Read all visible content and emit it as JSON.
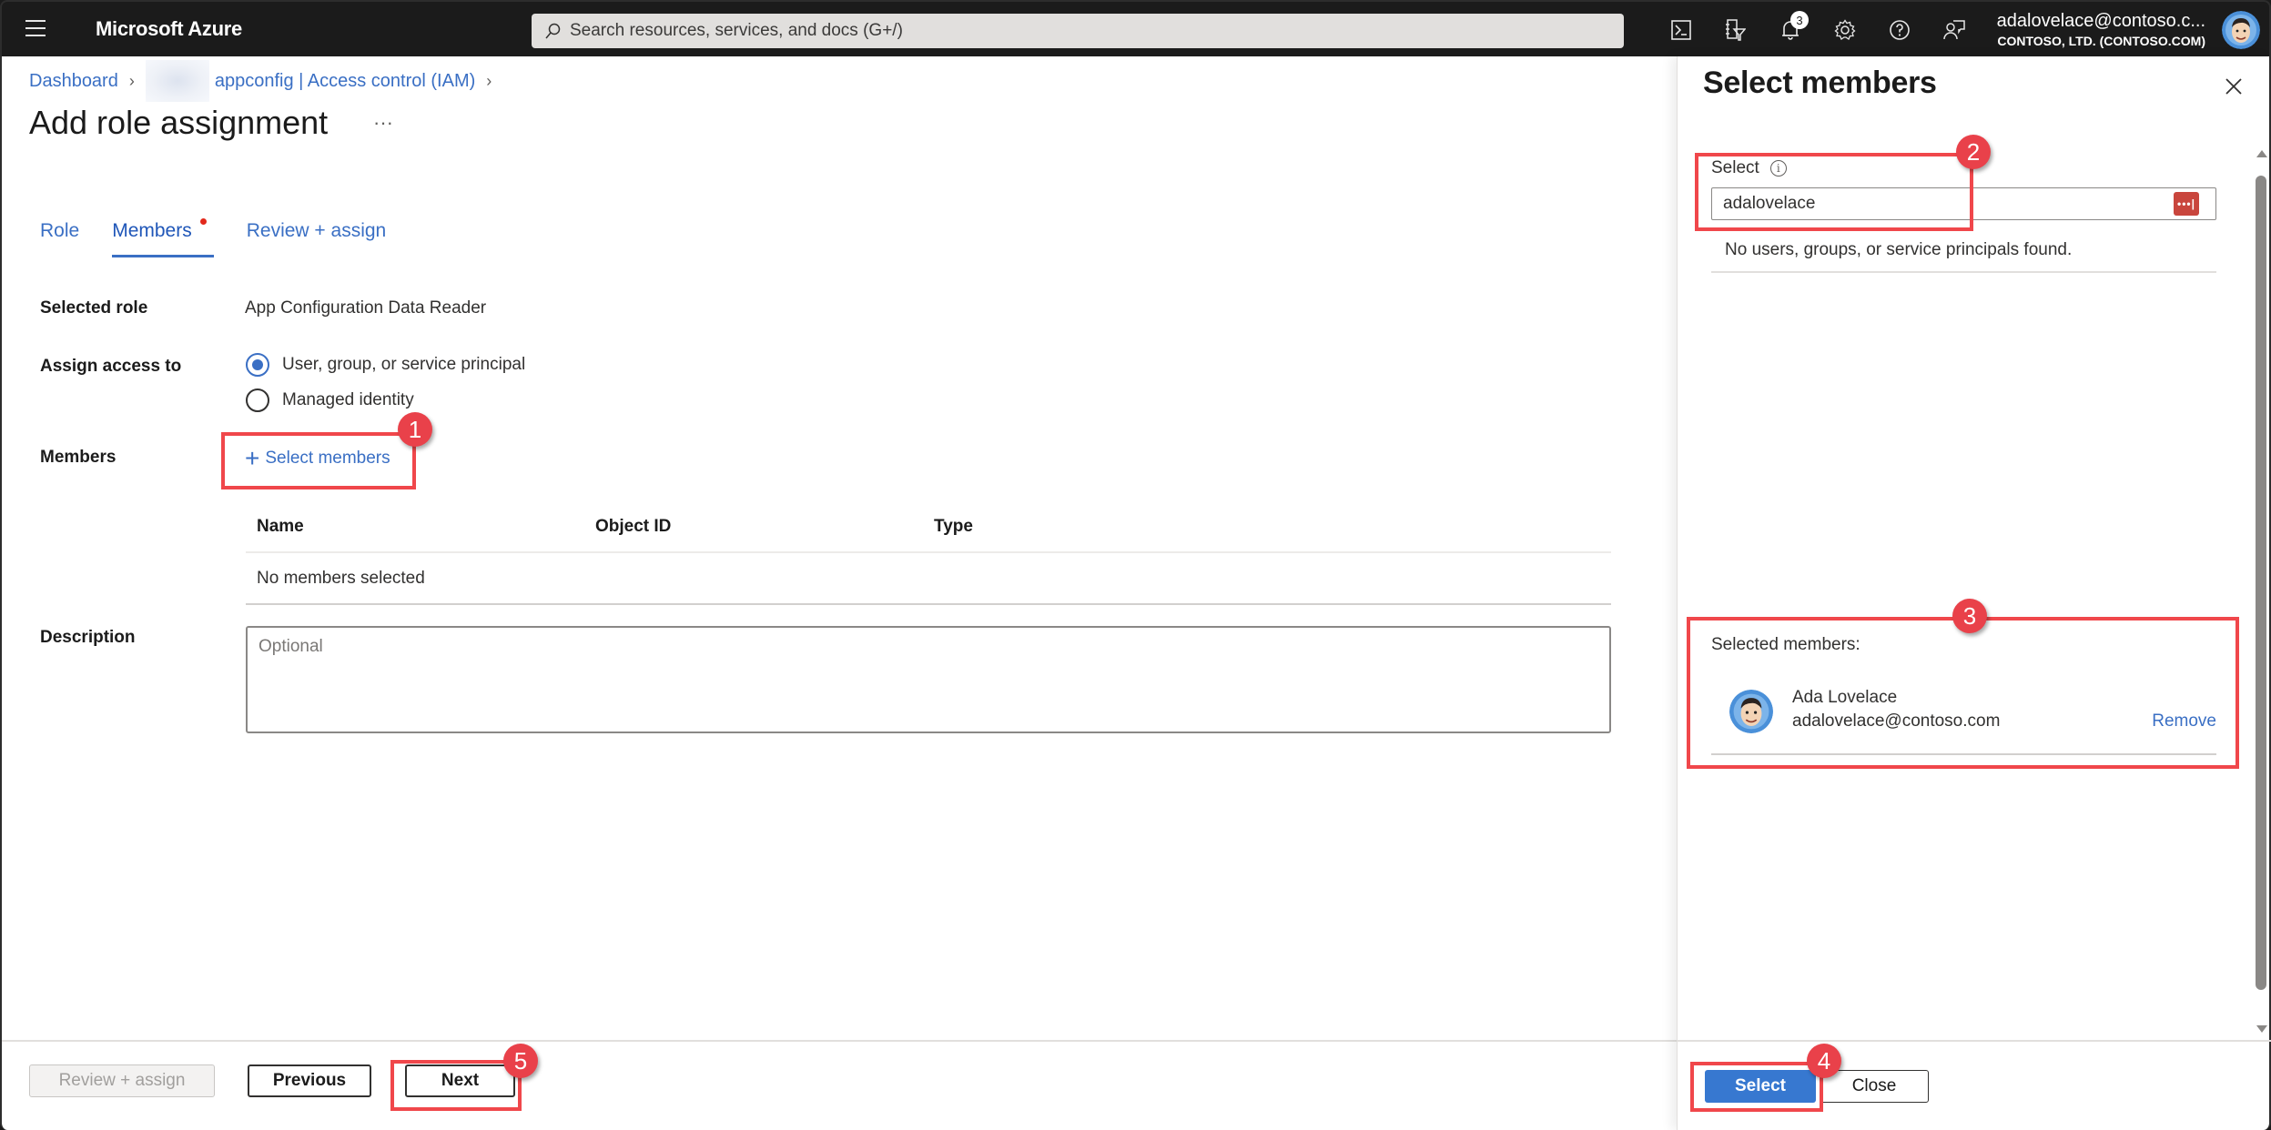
{
  "topbar": {
    "brand": "Microsoft Azure",
    "search_placeholder": "Search resources, services, and docs (G+/)",
    "icons": [
      "cloud-shell-icon",
      "directory-filter-icon",
      "notifications-icon",
      "settings-icon",
      "help-icon",
      "feedback-icon"
    ],
    "notification_count": "3",
    "account_email": "adalovelace@contoso.c...",
    "account_tenant": "CONTOSO, LTD. (CONTOSO.COM)"
  },
  "breadcrumb": {
    "items": [
      "Dashboard",
      "appconfig | Access control (IAM)"
    ]
  },
  "page": {
    "title": "Add role assignment",
    "more": "···"
  },
  "tabs": [
    {
      "label": "Role",
      "active": false
    },
    {
      "label": "Members",
      "active": true
    },
    {
      "label": "Review + assign",
      "active": false
    }
  ],
  "form": {
    "selected_role_label": "Selected role",
    "selected_role_value": "App Configuration Data Reader",
    "assign_access_label": "Assign access to",
    "assign_options": [
      {
        "label": "User, group, or service principal",
        "checked": true
      },
      {
        "label": "Managed identity",
        "checked": false
      }
    ],
    "members_label": "Members",
    "select_members_link": "Select members",
    "table_columns": [
      "Name",
      "Object ID",
      "Type"
    ],
    "table_empty": "No members selected",
    "description_label": "Description",
    "description_placeholder": "Optional"
  },
  "footer": {
    "review_assign": "Review + assign",
    "previous": "Previous",
    "next": "Next"
  },
  "panel": {
    "title": "Select members",
    "select_label": "Select",
    "search_value": "adalovelace",
    "no_results": "No users, groups, or service principals found.",
    "selected_heading": "Selected members:",
    "selected_members": [
      {
        "name": "Ada Lovelace",
        "email": "adalovelace@contoso.com",
        "action": "Remove"
      }
    ],
    "select_button": "Select",
    "close_button": "Close"
  },
  "callouts": [
    "1",
    "2",
    "3",
    "4",
    "5"
  ],
  "colors": {
    "accent": "#3a6fc4",
    "primary_button": "#3778d0",
    "callout": "#e9414a",
    "topbar": "#1b1b1b"
  }
}
